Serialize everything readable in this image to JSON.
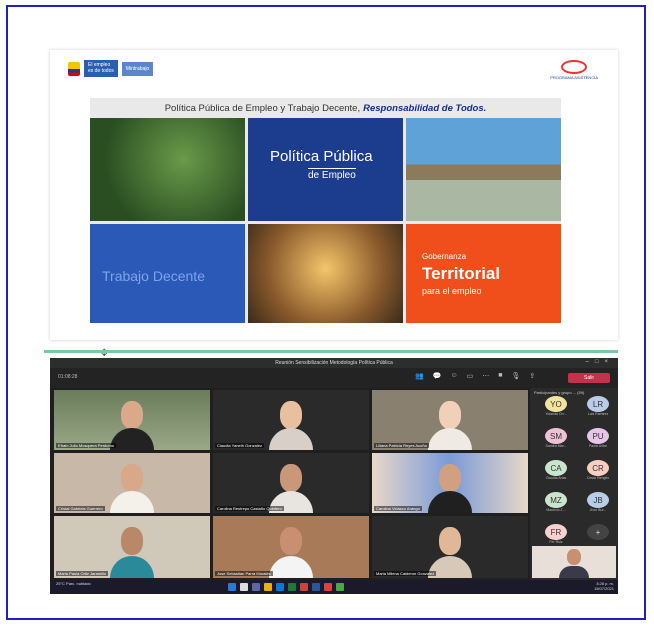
{
  "slide": {
    "gov_logo_line1": "El empleo",
    "gov_logo_line2": "es de todos",
    "gov_ministry": "Mintrabajo",
    "right_logo_text": "PROGRAMA ASISTENCIA",
    "banner_title_plain": "Política Pública de Empleo y Trabajo Decente,",
    "banner_title_bold": "Responsabilidad de Todos.",
    "tile_policy_big": "Política Pública",
    "tile_policy_small": "de Empleo",
    "tile_decent": "Trabajo Decente",
    "tile_gov_line1": "Gobernanza",
    "tile_gov_line2": "Territorial",
    "tile_gov_line3": "para el empleo"
  },
  "teams": {
    "window_title": "Reunión Sensibilización Metodología Política Pública",
    "timer": "01:08:28",
    "leave_label": "Salir",
    "participants": [
      {
        "name": "Efrain Julio Mosquera Perdomo"
      },
      {
        "name": "Claudia Yaneth Gonzalez"
      },
      {
        "name": "Liliana Patricia Reyes Acuña"
      },
      {
        "name": "Cristal Gabriela Guerrero"
      },
      {
        "name": "Carolina Restrepo Castaño Quintero"
      },
      {
        "name": "Carolina Velasco Arango"
      },
      {
        "name": "Maria Paula Ortiz Jaramillo"
      },
      {
        "name": "Jose Sebastian Parra Morales"
      },
      {
        "name": "Maria Milena Calderon Gonzalez"
      }
    ],
    "panel_header": "Participantes y grupo ... (59)",
    "avatars": [
      {
        "initials": "YO",
        "caption": "Yolanda Orr...",
        "color": "#f3e3a0"
      },
      {
        "initials": "LR",
        "caption": "Luis Ramirez",
        "color": "#b9cde8"
      },
      {
        "initials": "SM",
        "caption": "Sandra Mar...",
        "color": "#eec2d6"
      },
      {
        "initials": "PU",
        "caption": "Paola Uribe",
        "color": "#e6c5e6"
      },
      {
        "initials": "CA",
        "caption": "Claudia Arias",
        "color": "#c9e6cc"
      },
      {
        "initials": "CR",
        "caption": "Cesar Rengifo",
        "color": "#f7cfc0"
      },
      {
        "initials": "MZ",
        "caption": "Mauricio Z...",
        "color": "#c9e6cc"
      },
      {
        "initials": "JB",
        "caption": "Jhon Bur...",
        "color": "#b9cde8"
      },
      {
        "initials": "FR",
        "caption": "Fer Ruiz",
        "color": "#f7d0d0"
      },
      {
        "initials": "+",
        "caption": "",
        "color": "#444444"
      }
    ],
    "weather": "25°C Parc. nublado",
    "clock_time": "3:28 p. m.",
    "clock_date": "15/07/2021"
  },
  "colors": {
    "frame": "#2020c0",
    "divider": "#7cc8a0",
    "leave": "#c4314b"
  }
}
